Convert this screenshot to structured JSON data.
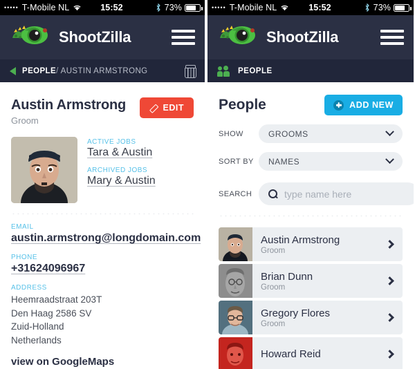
{
  "status_bar": {
    "signal_dots": "•••••",
    "carrier": "T-Mobile NL",
    "time": "15:52",
    "battery_percent": "73%",
    "wifi_icon": "wifi-icon",
    "bluetooth_icon": "bluetooth-icon"
  },
  "app": {
    "brand": "ShootZilla",
    "logo_icon": "shootzilla-chameleon-logo",
    "menu_icon": "hamburger-menu-icon"
  },
  "left": {
    "breadcrumb": {
      "back_icon": "back-arrow-icon",
      "root": "PEOPLE",
      "separator": "/",
      "current": "AUSTIN ARMSTRONG",
      "delete_icon": "trash-icon"
    },
    "person": {
      "name": "Austin Armstrong",
      "role": "Groom",
      "avatar": "austin-armstrong-photo"
    },
    "edit_button": {
      "label": "EDIT",
      "icon": "pencil-icon",
      "color": "#ef4836"
    },
    "jobs": [
      {
        "label": "ACTIVE JOBS",
        "value": "Tara & Austin"
      },
      {
        "label": "ARCHIVED JOBS",
        "value": "Mary & Austin"
      }
    ],
    "fields": [
      {
        "label": "EMAIL",
        "value": "austin.armstrong@longdomain.com"
      },
      {
        "label": "PHONE",
        "value": "+31624096967"
      }
    ],
    "address": {
      "label": "ADDRESS",
      "lines": [
        "Heemraadstraat 203T",
        "Den Haag 2586 SV",
        "Zuid-Holland",
        "Netherlands"
      ]
    },
    "maps_link": "view on GoogleMaps"
  },
  "right": {
    "section_bar": {
      "icon": "people-icon",
      "label": "PEOPLE"
    },
    "title": "People",
    "add_button": {
      "label": "ADD NEW",
      "icon": "plus-circle-icon",
      "color": "#19ade4"
    },
    "controls": [
      {
        "label": "SHOW",
        "value": "GROOMS",
        "icon": "chevron-down-icon"
      },
      {
        "label": "SORT BY",
        "value": "NAMES",
        "icon": "chevron-down-icon"
      }
    ],
    "search": {
      "label": "SEARCH",
      "value": "",
      "placeholder": "type name here",
      "icon": "search-icon"
    },
    "people": [
      {
        "name": "Austin Armstrong",
        "role": "Groom",
        "avatar": "austin-photo",
        "chevron": "chevron-right-icon"
      },
      {
        "name": "Brian Dunn",
        "role": "Groom",
        "avatar": "brian-photo",
        "chevron": "chevron-right-icon"
      },
      {
        "name": "Gregory Flores",
        "role": "Groom",
        "avatar": "gregory-photo",
        "chevron": "chevron-right-icon"
      },
      {
        "name": "Howard Reid",
        "role": "",
        "avatar": "howard-photo",
        "chevron": "chevron-right-icon"
      }
    ]
  }
}
